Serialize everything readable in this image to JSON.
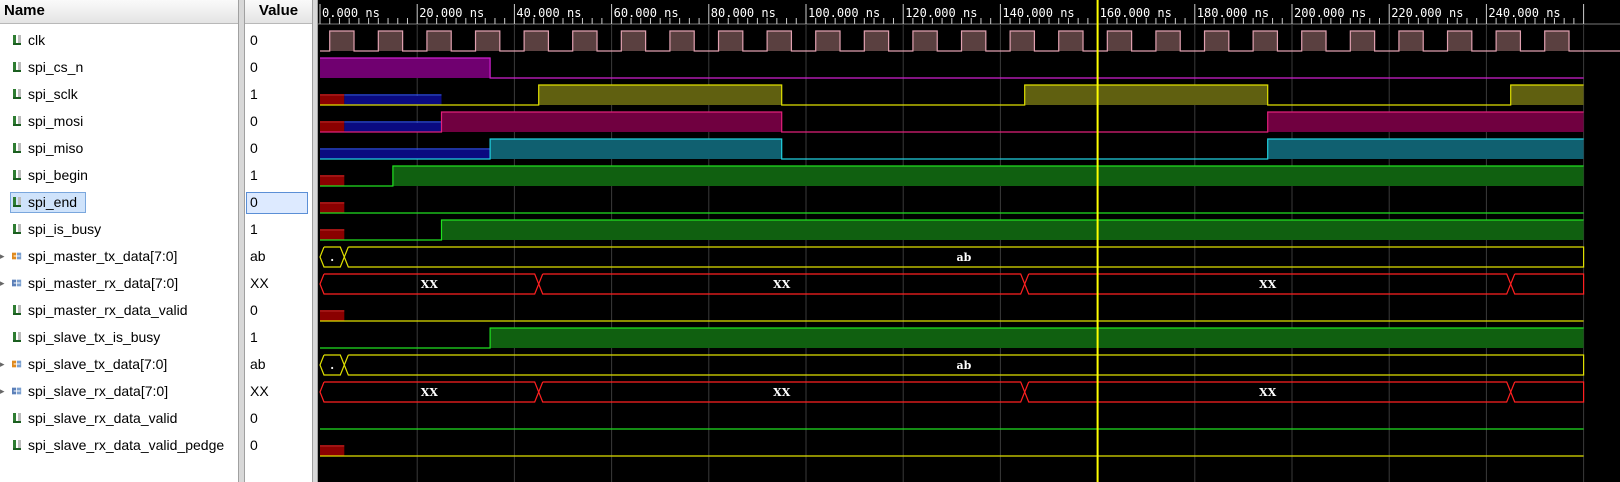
{
  "columns": {
    "name_header": "Name",
    "value_header": "Value"
  },
  "time_axis": {
    "unit": "ns",
    "labels": [
      "0.000 ns",
      "20.000 ns",
      "40.000 ns",
      "60.000 ns",
      "80.000 ns",
      "100.000 ns",
      "120.000 ns",
      "140.000 ns",
      "160.000 ns",
      "180.000 ns",
      "200.000 ns",
      "220.000 ns",
      "240.000 ns"
    ]
  },
  "cursor": {
    "time_ns": 160,
    "color": "#ffff00"
  },
  "selected_signal": "spi_end",
  "signals": [
    {
      "name": "clk",
      "value": "0",
      "kind": "bit",
      "expandable": false
    },
    {
      "name": "spi_cs_n",
      "value": "0",
      "kind": "bit",
      "expandable": false
    },
    {
      "name": "spi_sclk",
      "value": "1",
      "kind": "bit",
      "expandable": false
    },
    {
      "name": "spi_mosi",
      "value": "0",
      "kind": "bit",
      "expandable": false
    },
    {
      "name": "spi_miso",
      "value": "0",
      "kind": "bit",
      "expandable": false
    },
    {
      "name": "spi_begin",
      "value": "1",
      "kind": "bit",
      "expandable": false
    },
    {
      "name": "spi_end",
      "value": "0",
      "kind": "bit",
      "expandable": false
    },
    {
      "name": "spi_is_busy",
      "value": "1",
      "kind": "bit",
      "expandable": false
    },
    {
      "name": "spi_master_tx_data[7:0]",
      "value": "ab",
      "kind": "bus-in",
      "expandable": true
    },
    {
      "name": "spi_master_rx_data[7:0]",
      "value": "XX",
      "kind": "bus-out",
      "expandable": true
    },
    {
      "name": "spi_master_rx_data_valid",
      "value": "0",
      "kind": "bit",
      "expandable": false
    },
    {
      "name": "spi_slave_tx_is_busy",
      "value": "1",
      "kind": "bit",
      "expandable": false
    },
    {
      "name": "spi_slave_tx_data[7:0]",
      "value": "ab",
      "kind": "bus-in",
      "expandable": true
    },
    {
      "name": "spi_slave_rx_data[7:0]",
      "value": "XX",
      "kind": "bus-out",
      "expandable": true
    },
    {
      "name": "spi_slave_rx_data_valid",
      "value": "0",
      "kind": "bit",
      "expandable": false
    },
    {
      "name": "spi_slave_rx_data_valid_pedge",
      "value": "0",
      "kind": "bit",
      "expandable": false
    }
  ],
  "waves": [
    {
      "type": "clock",
      "color": "#e0a0b0",
      "fill": "#5a4040",
      "period_ns": 10,
      "first_rise_ns": 2
    },
    {
      "type": "bit",
      "color": "#d020d0",
      "fill": "#700070",
      "segments": [
        [
          0,
          35,
          "1"
        ],
        [
          35,
          260,
          "0"
        ]
      ]
    },
    {
      "type": "bit",
      "color": "#e0e000",
      "fill": "#606010",
      "segments": [
        [
          0,
          5,
          "X"
        ],
        [
          5,
          25,
          "Z"
        ],
        [
          25,
          45,
          "0"
        ],
        [
          45,
          95,
          "1"
        ],
        [
          95,
          145,
          "0"
        ],
        [
          145,
          195,
          "1"
        ],
        [
          195,
          245,
          "0"
        ],
        [
          245,
          260,
          "1"
        ]
      ]
    },
    {
      "type": "bit",
      "color": "#e0207a",
      "fill": "#700040",
      "segments": [
        [
          0,
          5,
          "X"
        ],
        [
          5,
          25,
          "Z"
        ],
        [
          25,
          95,
          "1"
        ],
        [
          95,
          195,
          "0"
        ],
        [
          195,
          260,
          "1"
        ]
      ]
    },
    {
      "type": "bit",
      "color": "#20d0e0",
      "fill": "#106070",
      "segments": [
        [
          0,
          35,
          "Z"
        ],
        [
          35,
          95,
          "1"
        ],
        [
          95,
          195,
          "0"
        ],
        [
          195,
          260,
          "1"
        ]
      ]
    },
    {
      "type": "bit",
      "color": "#20e020",
      "fill": "#106010",
      "segments": [
        [
          0,
          5,
          "X"
        ],
        [
          5,
          15,
          "0"
        ],
        [
          15,
          260,
          "1"
        ]
      ]
    },
    {
      "type": "bit",
      "color": "#20e020",
      "fill": "#106010",
      "segments": [
        [
          0,
          5,
          "X"
        ],
        [
          5,
          260,
          "0"
        ]
      ]
    },
    {
      "type": "bit",
      "color": "#20e020",
      "fill": "#106010",
      "segments": [
        [
          0,
          5,
          "X"
        ],
        [
          5,
          25,
          "0"
        ],
        [
          25,
          260,
          "1"
        ]
      ]
    },
    {
      "type": "bus",
      "color": "#e0e000",
      "segments": [
        [
          0,
          5,
          "."
        ],
        [
          5,
          260,
          "ab"
        ]
      ]
    },
    {
      "type": "bus",
      "color": "#ff2020",
      "segments": [
        [
          0,
          45,
          "XX"
        ],
        [
          45,
          145,
          "XX"
        ],
        [
          145,
          245,
          "XX"
        ],
        [
          245,
          260,
          ""
        ]
      ]
    },
    {
      "type": "bit",
      "color": "#e0e000",
      "fill": "#606010",
      "segments": [
        [
          0,
          5,
          "X"
        ],
        [
          5,
          260,
          "0"
        ]
      ]
    },
    {
      "type": "bit",
      "color": "#20e020",
      "fill": "#106010",
      "segments": [
        [
          0,
          35,
          "0"
        ],
        [
          35,
          260,
          "1"
        ]
      ]
    },
    {
      "type": "bus",
      "color": "#e0e000",
      "segments": [
        [
          0,
          5,
          "."
        ],
        [
          5,
          260,
          "ab"
        ]
      ]
    },
    {
      "type": "bus",
      "color": "#ff2020",
      "segments": [
        [
          0,
          45,
          "XX"
        ],
        [
          45,
          145,
          "XX"
        ],
        [
          145,
          245,
          "XX"
        ],
        [
          245,
          260,
          ""
        ]
      ]
    },
    {
      "type": "bit",
      "color": "#20e020",
      "fill": "#106010",
      "segments": [
        [
          0,
          260,
          "0"
        ]
      ]
    },
    {
      "type": "bit",
      "color": "#e0e000",
      "fill": "#606010",
      "segments": [
        [
          0,
          5,
          "X"
        ],
        [
          5,
          260,
          "0"
        ]
      ]
    }
  ]
}
